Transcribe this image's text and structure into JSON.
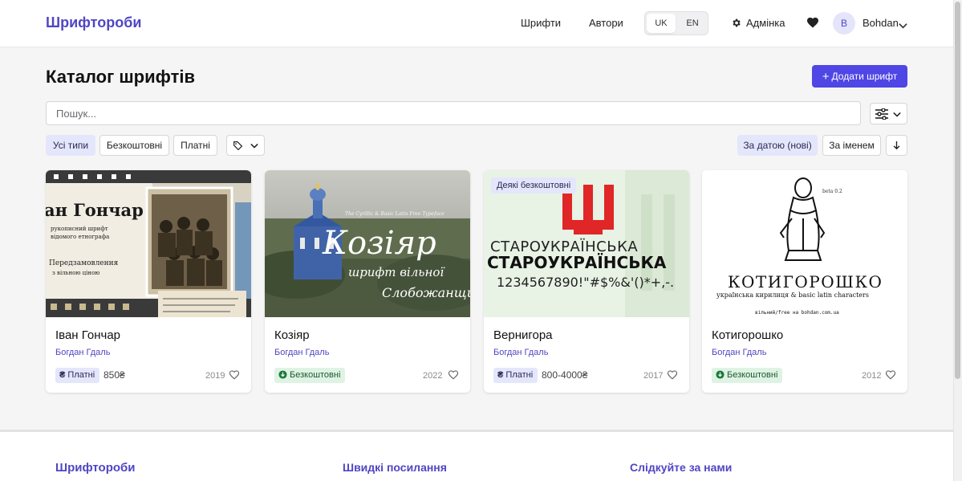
{
  "header": {
    "logo": "Шрифтороби",
    "nav": [
      "Шрифти",
      "Автори"
    ],
    "lang": [
      "UK",
      "EN"
    ],
    "admin": "Адмінка",
    "avatar_initial": "B",
    "username": "Bohdan"
  },
  "page": {
    "title": "Каталог шрифтів",
    "add_button": "Додати шрифт",
    "search_placeholder": "Пошук..."
  },
  "filters": {
    "types": [
      "Усі типи",
      "Безкоштовні",
      "Платні"
    ],
    "sort_date": "За датою (нові)",
    "sort_name": "За іменем"
  },
  "cards": [
    {
      "name": "Іван Гончар",
      "author": "Богдан Гдаль",
      "badge": "Платні",
      "price": "850₴",
      "year": "2019",
      "art": {
        "title": "ан Гончар",
        "lines": [
          "рукописний шрифт",
          "відомого етнографа"
        ],
        "pre": [
          "Передзамовлення",
          "з вільною ціною"
        ]
      }
    },
    {
      "name": "Козіяр",
      "author": "Богдан Гдаль",
      "badge": "Безкоштовні",
      "year": "2022",
      "art": {
        "tagline": "The Cyrillic & Basic Latin Free Typeface",
        "title": "Козіяр",
        "sub1": "шрифт вільної",
        "sub2": "Слобожанщини"
      }
    },
    {
      "name": "Вернигора",
      "author": "Богдан Гдаль",
      "badge": "Платні",
      "price": "800-4000₴",
      "year": "2017",
      "overlay": "Деякі безкоштовні",
      "art": {
        "line1": "СТАРОУКРАЇНСЬКА",
        "line2": "СТАРОУКРАЇНСЬКА",
        "digits": "1234567890!\"#$%&'()*+,-."
      }
    },
    {
      "name": "Котигорошко",
      "author": "Богдан Гдаль",
      "badge": "Безкоштовні",
      "year": "2012",
      "art": {
        "beta": "beta 0.2",
        "title": "КОТИГОРОШКО",
        "sub": "українська кирилиця & basic latin characters",
        "small": "вільний/free на bohdan.com.ua"
      }
    }
  ],
  "footer": {
    "brand": "Шрифтороби",
    "links": "Швидкі посилання",
    "follow": "Слідкуйте за нами"
  },
  "colors": {
    "accent": "#4f46e5",
    "brand_text": "#4f46c4",
    "paid_bg": "#e4e6fb",
    "free_bg": "#dff3e4"
  }
}
